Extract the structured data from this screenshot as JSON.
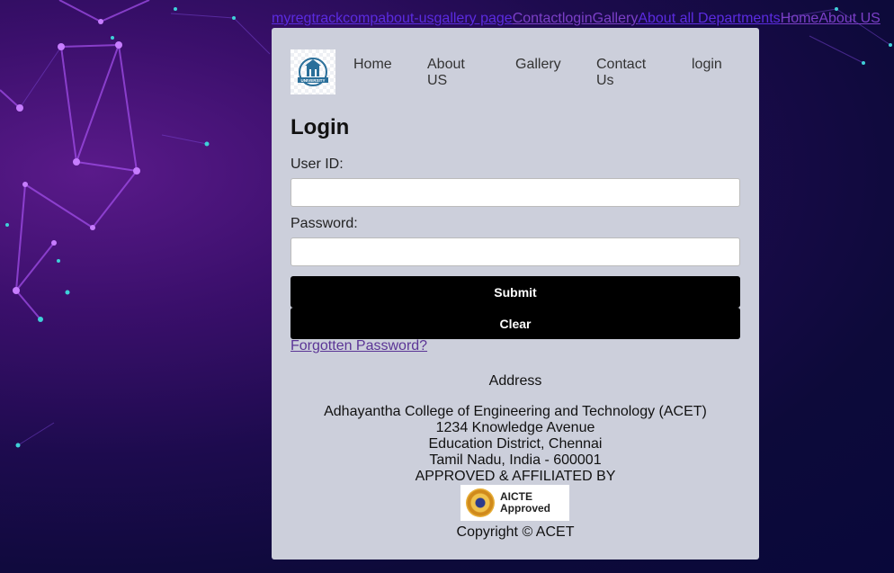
{
  "top_links": [
    {
      "label": "myregtrack",
      "visited": false
    },
    {
      "label": "compabout-us",
      "visited": false
    },
    {
      "label": "gallery page",
      "visited": false
    },
    {
      "label": "Contact",
      "visited": true
    },
    {
      "label": "login",
      "visited": true
    },
    {
      "label": "Gallery",
      "visited": true
    },
    {
      "label": "About all Departments",
      "visited": false
    },
    {
      "label": "Home",
      "visited": true
    },
    {
      "label": "About US",
      "visited": true
    }
  ],
  "nav": {
    "logo_text": "UNIVERSITY",
    "home": "Home",
    "about": "About US",
    "gallery": "Gallery",
    "contact": "Contact Us",
    "login": "login"
  },
  "form": {
    "title": "Login",
    "user_label": "User ID:",
    "user_value": "",
    "password_label": "Password:",
    "password_value": "",
    "submit_label": "Submit",
    "clear_label": "Clear",
    "forgot_label": "Forgotten Password?"
  },
  "footer": {
    "address_heading": "Address",
    "line1": "Adhayantha College of Engineering and Technology (ACET)",
    "line2": "1234 Knowledge Avenue",
    "line3": "Education District, Chennai",
    "line4": "Tamil Nadu, India - 600001",
    "approved": "APPROVED & AFFILIATED BY",
    "badge_line1": "AICTE",
    "badge_line2": "Approved",
    "copyright": "Copyright © ACET"
  },
  "colors": {
    "link": "#5b2be0",
    "visited_link": "#7b3fc7",
    "card_bg": "#cccfdb",
    "button_bg": "#000000"
  }
}
